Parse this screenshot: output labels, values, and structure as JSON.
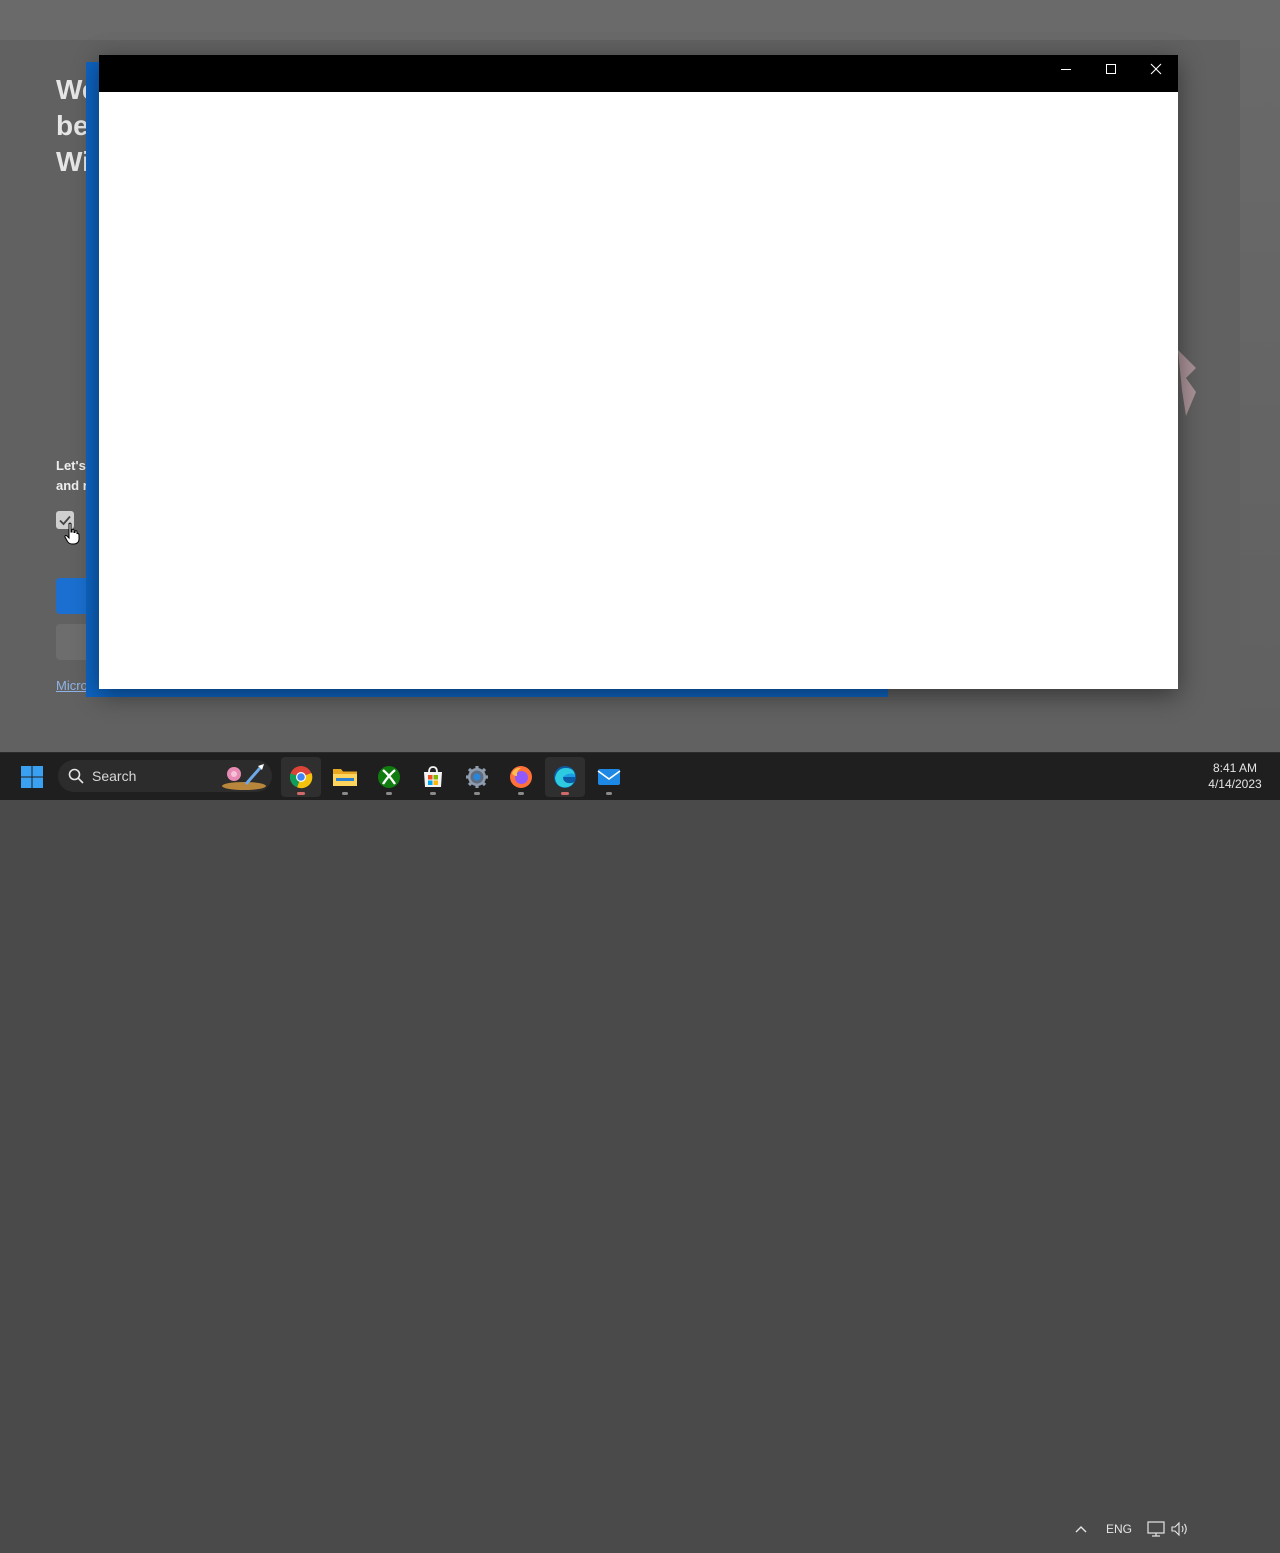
{
  "background_window": {
    "title": "We\nbe\nWi",
    "text_line1": "Let's",
    "text_line2": "and r",
    "link_text": "Micro"
  },
  "foreground_window": {
    "title": "",
    "controls": {
      "minimize_icon": "minimize-icon",
      "maximize_icon": "maximize-icon",
      "close_icon": "close-icon"
    }
  },
  "taskbar": {
    "search_label": "Search",
    "apps": [
      {
        "name": "Google Chrome",
        "icon": "chrome-icon",
        "active": true
      },
      {
        "name": "File Explorer",
        "icon": "folder-icon",
        "active": false
      },
      {
        "name": "Xbox",
        "icon": "xbox-icon",
        "active": false
      },
      {
        "name": "Microsoft Store",
        "icon": "store-icon",
        "active": false
      },
      {
        "name": "Settings",
        "icon": "gear-icon",
        "active": false
      },
      {
        "name": "Firefox",
        "icon": "firefox-icon",
        "active": false
      },
      {
        "name": "Microsoft Edge",
        "icon": "edge-icon",
        "active": true
      },
      {
        "name": "Mail",
        "icon": "mail-icon",
        "active": false
      }
    ],
    "tray": {
      "language": "ENG",
      "time": "8:41 AM",
      "date": "4/14/2023"
    }
  },
  "colors": {
    "titlebar": "#000000",
    "taskbar": "#1f1f1f",
    "accent_blue": "#0d64c2",
    "window_bg": "#ffffff"
  }
}
